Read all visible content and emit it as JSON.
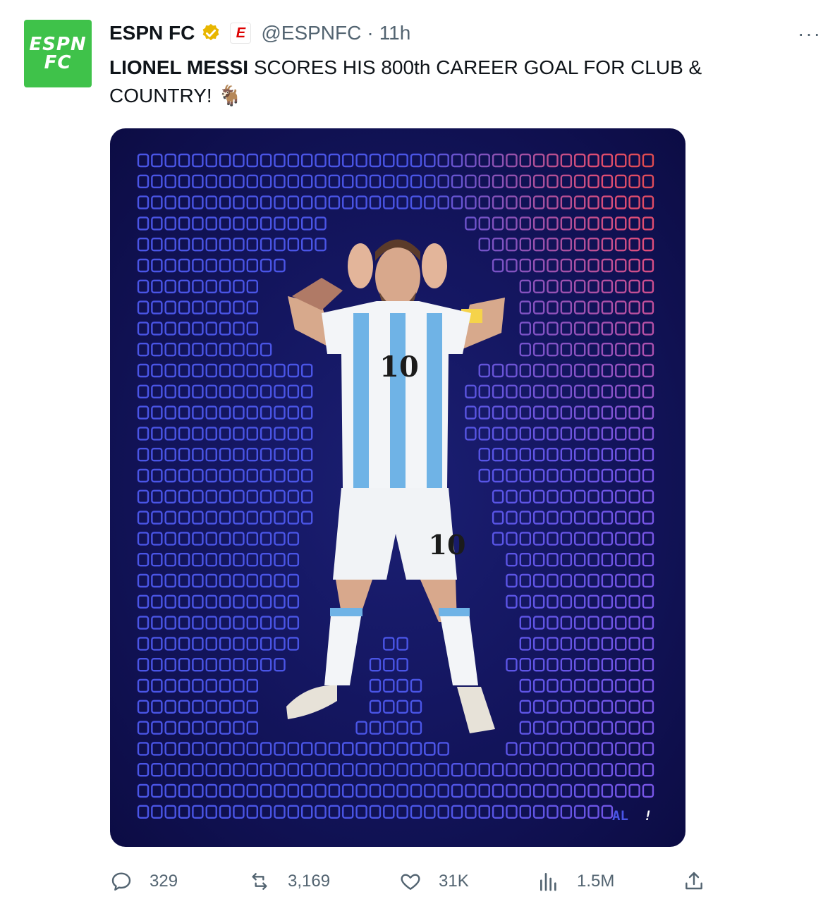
{
  "tweet": {
    "author_name": "ESPN FC",
    "handle": "@ESPNFC",
    "separator": "·",
    "time": "11h",
    "avatar_text_line1": "ESPN",
    "avatar_text_line2": "FC",
    "badge_letter": "E",
    "text_bold": "LIONEL MESSI",
    "text_rest": " SCORES HIS 800th CAREER GOAL FOR CLUB & COUNTRY! 🐐",
    "more_label": "···"
  },
  "media": {
    "ending_text": "AL",
    "ending_mark": "!",
    "jersey_number": "10",
    "shorts_number": "10"
  },
  "actions": {
    "replies": "329",
    "reposts": "3,169",
    "likes": "31K",
    "views": "1.5M"
  },
  "colors": {
    "avatar_green": "#3fc24a",
    "verified_gold": "#e8b600",
    "o_blue": "#4a55e6",
    "o_red": "#e04e4e",
    "shirt_blue": "#6fb3e6"
  },
  "icons": [
    "verified-badge-icon",
    "more-icon",
    "reply-icon",
    "repost-icon",
    "like-icon",
    "views-icon",
    "share-icon"
  ]
}
